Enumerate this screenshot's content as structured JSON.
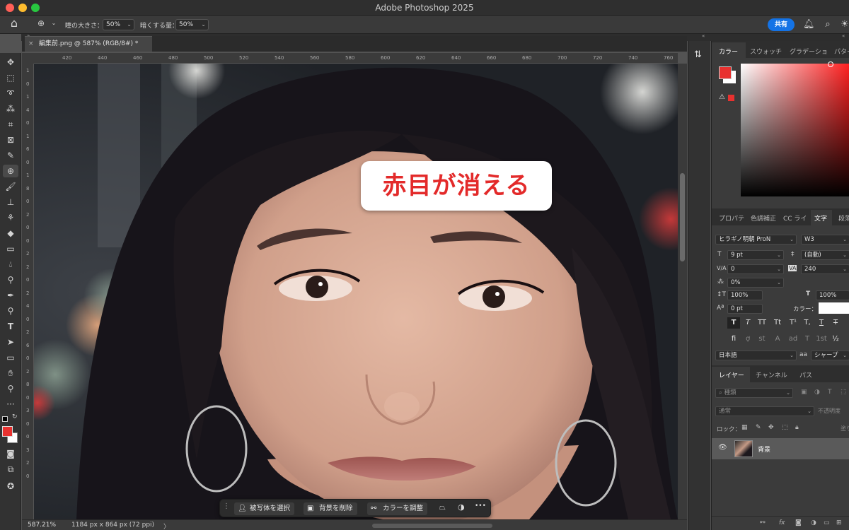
{
  "app": {
    "title": "Adobe Photoshop 2025",
    "share_label": "共有"
  },
  "options_bar": {
    "pupil_size_label": "瞳の大きさ：",
    "pupil_size_value": "50%",
    "darken_label": "暗くする量：",
    "darken_value": "50%"
  },
  "document": {
    "tab_title": "編集前.png @ 587% (RGB/8#) *",
    "close_symbol": "×",
    "zoom": "587.21%",
    "dimensions": "1184 px x 864 px (72 ppi)",
    "status_arrow": "〉"
  },
  "rulers": {
    "h_ticks": [
      "420",
      "440",
      "460",
      "480",
      "500",
      "520",
      "540",
      "560",
      "580",
      "600",
      "620",
      "640",
      "660",
      "680",
      "700",
      "720",
      "740",
      "760"
    ],
    "v_ticks": [
      "1",
      "0",
      "1",
      "4",
      "0",
      "1",
      "6",
      "0",
      "1",
      "8",
      "0",
      "2",
      "0",
      "0",
      "2",
      "2",
      "0",
      "2",
      "4",
      "0",
      "2",
      "6",
      "0",
      "2",
      "8",
      "0",
      "3",
      "0",
      "0",
      "3",
      "2",
      "0"
    ]
  },
  "overlay": {
    "caption": "赤目が消える"
  },
  "context_bar": {
    "select_subject": "被写体を選択",
    "remove_background": "背景を削除",
    "adjust_color": "カラーを調整",
    "more": "•••"
  },
  "color_panel": {
    "tabs": [
      "カラー",
      "スウォッチ",
      "グラデーショ",
      "パター"
    ],
    "foreground_color": "#e8312f",
    "background_color": "#ffffff"
  },
  "properties_panel": {
    "tabs": [
      "プロパテ",
      "色調補正",
      "CC ライ",
      "文字",
      "段落"
    ],
    "font_family": "ヒラギノ明朝 ProN",
    "font_weight": "W3",
    "font_size": "9 pt",
    "leading": "(自動)",
    "kerning": "0",
    "tracking": "240",
    "tsume": "0%",
    "vertical_scale": "100%",
    "horizontal_scale": "100%",
    "baseline_shift": "0 pt",
    "color_label": "カラー：",
    "language": "日本語",
    "aa_label": "a",
    "antialias": "シャープ",
    "type_buttons_row1": [
      "T",
      "T",
      "TT",
      "Tt",
      "T¹",
      "T,",
      "T",
      "T"
    ],
    "type_buttons_row2": [
      "fi",
      "ợ",
      "st",
      "A",
      "ad",
      "T",
      "1st",
      "½"
    ]
  },
  "layers_panel": {
    "tabs": [
      "レイヤー",
      "チャンネル",
      "パス"
    ],
    "search_placeholder": "種類",
    "blend_mode": "通常",
    "opacity_label": "不透明度",
    "lock_label": "ロック：",
    "fill_label": "塗り",
    "layer_name": "背景"
  }
}
